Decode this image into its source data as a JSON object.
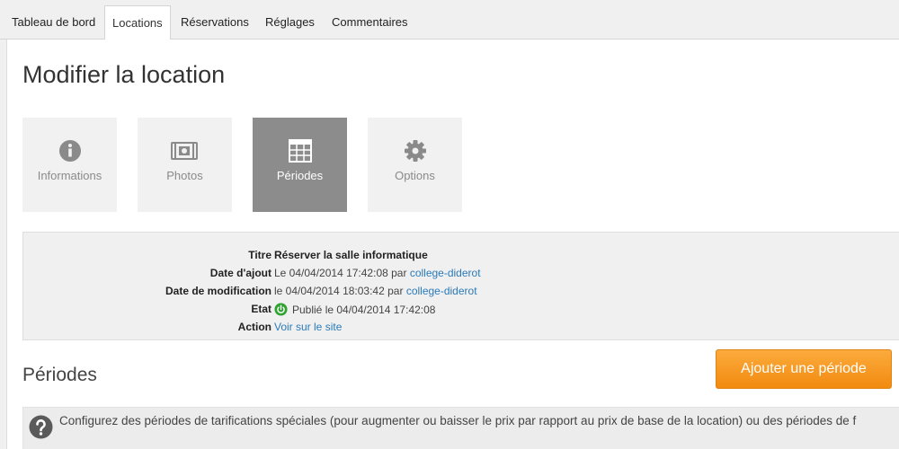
{
  "tabs": [
    {
      "label": "Tableau de bord",
      "active": false
    },
    {
      "label": "Locations",
      "active": true
    },
    {
      "label": "Réservations",
      "active": false
    },
    {
      "label": "Réglages",
      "active": false
    },
    {
      "label": "Commentaires",
      "active": false
    }
  ],
  "page": {
    "title": "Modifier la location"
  },
  "section_tabs": [
    {
      "label": "Informations",
      "icon": "info-icon",
      "active": false
    },
    {
      "label": "Photos",
      "icon": "camera-icon",
      "active": false
    },
    {
      "label": "Périodes",
      "icon": "calendar-icon",
      "active": true
    },
    {
      "label": "Options",
      "icon": "gear-icon",
      "active": false
    }
  ],
  "info": {
    "titre": {
      "label": "Titre",
      "value": "Réserver la salle informatique"
    },
    "date_ajout": {
      "label": "Date d'ajout",
      "value": "Le 04/04/2014 17:42:08 par",
      "author": "college-diderot"
    },
    "date_modif": {
      "label": "Date de modification",
      "value": "le 04/04/2014 18:03:42 par",
      "author": "college-diderot"
    },
    "etat": {
      "label": "Etat",
      "value": "Publié le 04/04/2014 17:42:08",
      "icon": "power-published-icon"
    },
    "action": {
      "label": "Action",
      "link": "Voir sur le site"
    }
  },
  "periodes": {
    "title": "Périodes",
    "add_button": "Ajouter une période",
    "help_text": "Configurez des périodes de tarifications spéciales (pour augmenter ou baisser le prix par rapport au prix de base de la location) ou des périodes de f"
  },
  "colors": {
    "accent_orange": "#f59a23",
    "link_blue": "#2a7ab8",
    "status_green": "#2fa232",
    "active_tab_gray": "#8c8c8c"
  }
}
